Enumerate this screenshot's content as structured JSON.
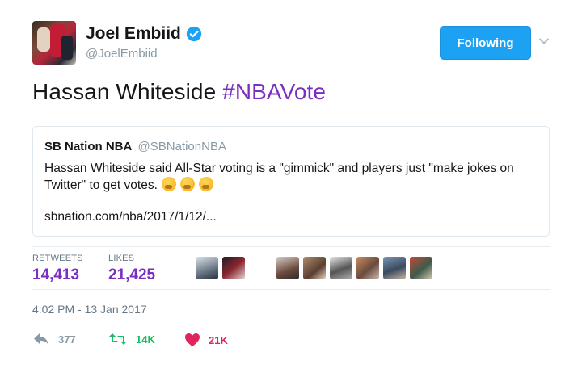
{
  "author": {
    "name": "Joel Embiid",
    "handle": "@JoelEmbiid",
    "verified_icon": "verified-badge-icon",
    "avatar_icon": "avatar"
  },
  "follow_button": {
    "label": "Following",
    "color": "#1da1f2"
  },
  "tweet": {
    "text_plain": "Hassan Whiteside ",
    "hashtag": "#NBAVote",
    "hashtag_color": "#7a2fc0"
  },
  "quoted_tweet": {
    "name": "SB Nation NBA",
    "handle": "@SBNationNBA",
    "body": "Hassan Whiteside said All-Star voting is a \"gimmick\" and players just \"make jokes on Twitter\" to get votes.",
    "emoji": "thinking-face-icon",
    "link": "sbnation.com/nba/2017/1/12/..."
  },
  "stats": {
    "retweets_label": "RETWEETS",
    "retweets_value": "14,413",
    "likes_label": "LIKES",
    "likes_value": "21,425"
  },
  "timestamp": "4:02 PM - 13 Jan 2017",
  "actions": {
    "reply_count": "377",
    "retweet_count": "14K",
    "like_count": "21K",
    "reply_color": "#8899a6",
    "retweet_color": "#17bf63",
    "like_color": "#e0245e"
  }
}
